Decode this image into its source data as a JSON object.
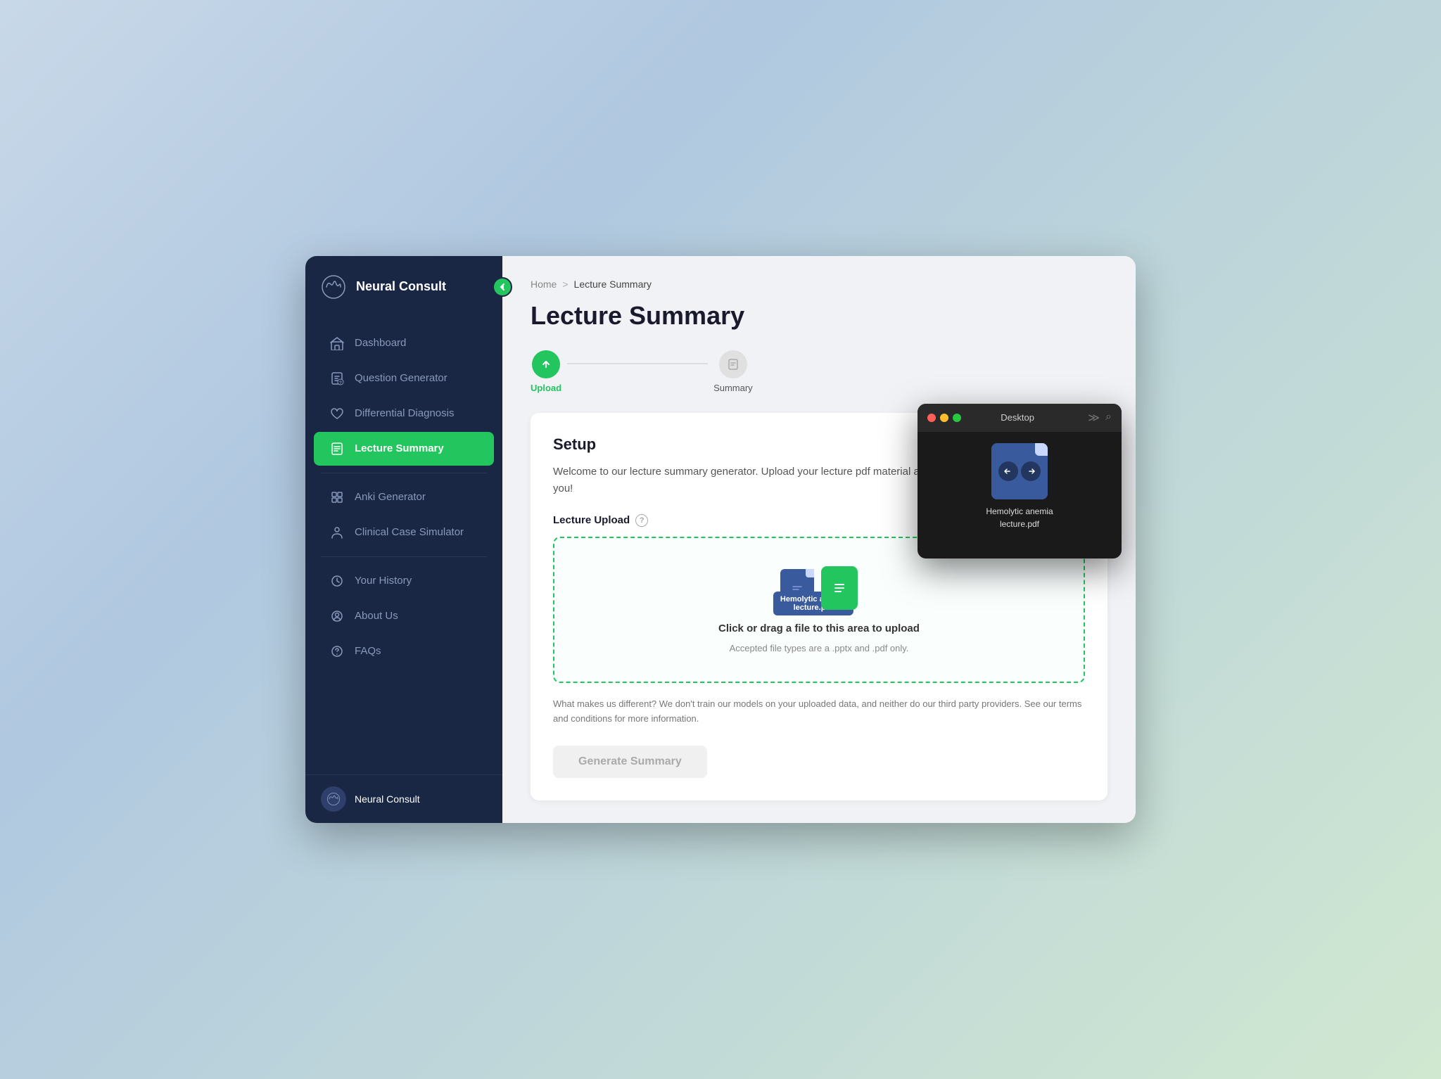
{
  "app": {
    "name": "Neural Consult",
    "window_title": "Desktop"
  },
  "sidebar": {
    "title": "Neural Consult",
    "collapse_icon": "◀",
    "items": [
      {
        "id": "dashboard",
        "label": "Dashboard",
        "icon": "home",
        "active": false
      },
      {
        "id": "question-generator",
        "label": "Question Generator",
        "icon": "document-question",
        "active": false
      },
      {
        "id": "differential-diagnosis",
        "label": "Differential Diagnosis",
        "icon": "heart-pulse",
        "active": false
      },
      {
        "id": "lecture-summary",
        "label": "Lecture Summary",
        "icon": "document-lines",
        "active": true
      }
    ],
    "items2": [
      {
        "id": "anki-generator",
        "label": "Anki Generator",
        "icon": "grid",
        "active": false
      },
      {
        "id": "clinical-case",
        "label": "Clinical Case Simulator",
        "icon": "person",
        "active": false
      }
    ],
    "bottom_items": [
      {
        "id": "your-history",
        "label": "Your History",
        "icon": "clock",
        "active": false
      },
      {
        "id": "about-us",
        "label": "About Us",
        "icon": "person-circle",
        "active": false
      },
      {
        "id": "faqs",
        "label": "FAQs",
        "icon": "question-circle",
        "active": false
      }
    ],
    "footer_name": "Neural Consult"
  },
  "breadcrumb": {
    "home": "Home",
    "separator": ">",
    "current": "Lecture Summary"
  },
  "page": {
    "title": "Lecture Summary"
  },
  "stepper": {
    "steps": [
      {
        "id": "upload",
        "label": "Upload",
        "active": true
      },
      {
        "id": "summary",
        "label": "Summary",
        "active": false
      }
    ]
  },
  "setup": {
    "title": "Setup",
    "description": "Welcome to our lecture summary generator. Upload your lecture pdf material and let us generate a summary for you!",
    "upload_label": "Lecture Upload",
    "upload_main_text": "Click or drag a file to this area to upload",
    "upload_sub_text": "Accepted file types are a .pptx and .pdf only.",
    "privacy_note": "What makes us different? We don't train our models on your uploaded data, and neither do our third party providers. See our terms and conditions for more information.",
    "generate_btn": "Generate Summary",
    "file_being_dragged": "Hemolytic anemia\nlecture.pdf"
  },
  "desktop_window": {
    "title": "Desktop",
    "file_name": "Hemolytic anemia\nlecture.pdf"
  }
}
